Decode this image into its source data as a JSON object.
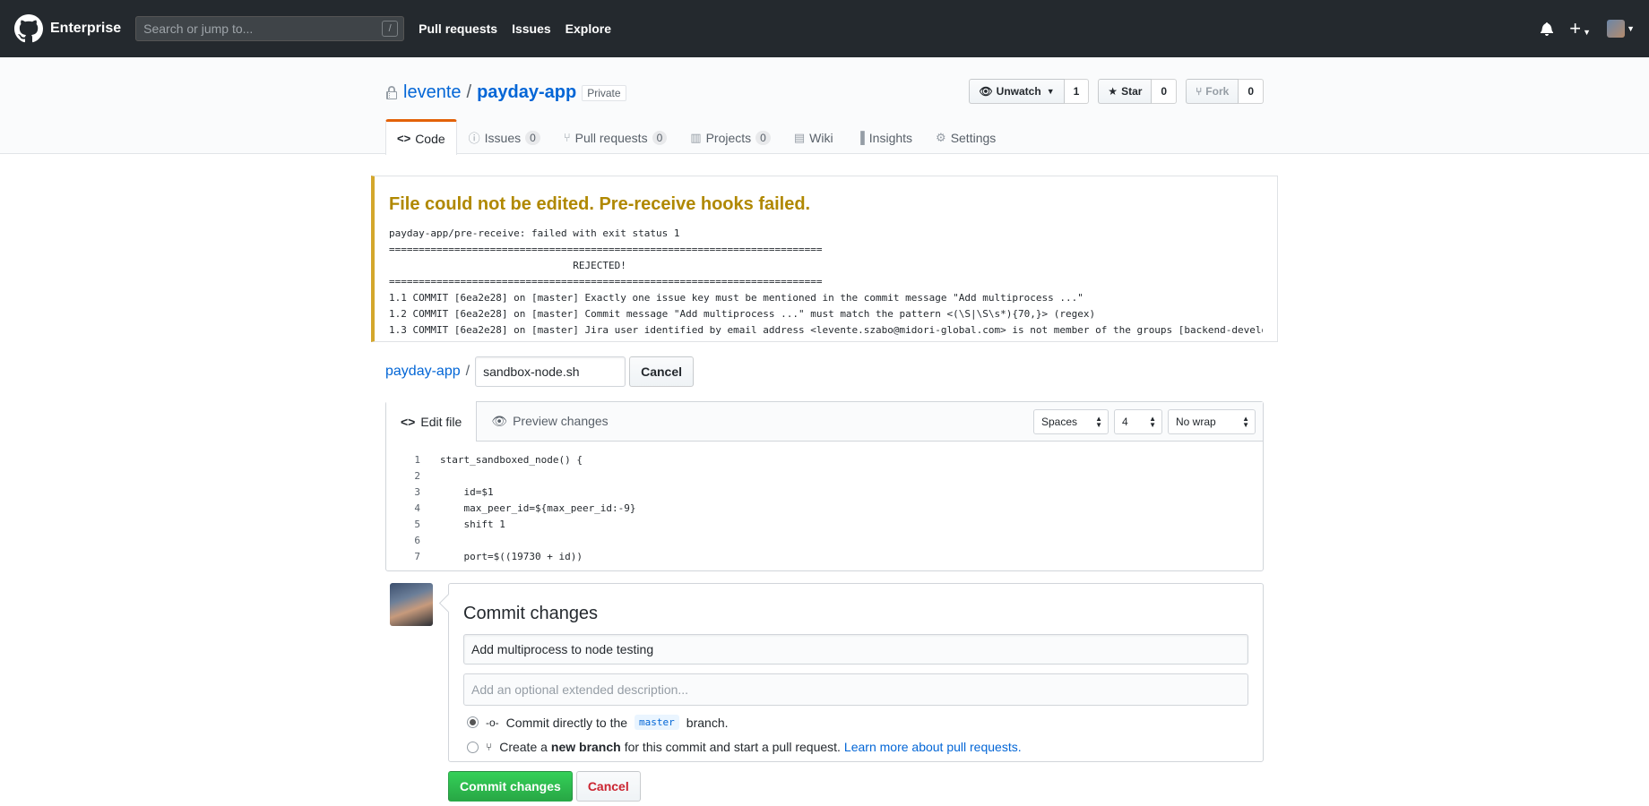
{
  "header": {
    "brand": "Enterprise",
    "search_placeholder": "Search or jump to...",
    "search_shortcut": "/",
    "nav": [
      "Pull requests",
      "Issues",
      "Explore"
    ]
  },
  "repo": {
    "owner": "levente",
    "separator": "/",
    "name": "payday-app",
    "visibility": "Private",
    "actions": {
      "watch_label": "Unwatch",
      "watch_count": "1",
      "star_label": "Star",
      "star_count": "0",
      "fork_label": "Fork",
      "fork_count": "0"
    },
    "tabs": [
      {
        "label": "Code",
        "icon": "code-icon",
        "count": null,
        "selected": true
      },
      {
        "label": "Issues",
        "icon": "issue-icon",
        "count": "0"
      },
      {
        "label": "Pull requests",
        "icon": "pull-request-icon",
        "count": "0"
      },
      {
        "label": "Projects",
        "icon": "project-icon",
        "count": "0"
      },
      {
        "label": "Wiki",
        "icon": "book-icon",
        "count": null
      },
      {
        "label": "Insights",
        "icon": "graph-icon",
        "count": null
      },
      {
        "label": "Settings",
        "icon": "gear-icon",
        "count": null
      }
    ]
  },
  "flash": {
    "title": "File could not be edited. Pre-receive hooks failed.",
    "lines": [
      "payday-app/pre-receive: failed with exit status 1",
      "=========================================================================",
      "                               REJECTED!",
      "=========================================================================",
      "1.1 COMMIT [6ea2e28] on [master] Exactly one issue key must be mentioned in the commit message \"Add multiprocess ...\"",
      "1.2 COMMIT [6ea2e28] on [master] Commit message \"Add multiprocess ...\" must match the pattern <(\\S|\\S\\s*){70,}> (regex)",
      "1.3 COMMIT [6ea2e28] on [master] Jira user identified by email address <levente.szabo@midori-global.com> is not member of the groups [backend-developers]"
    ]
  },
  "editor": {
    "breadcrumb_repo": "payday-app",
    "filename": "sandbox-node.sh",
    "cancel_label": "Cancel",
    "tab_edit": "Edit file",
    "tab_preview": "Preview changes",
    "indent_mode": "Spaces",
    "indent_size": "4",
    "wrap_mode": "No wrap",
    "code": [
      {
        "n": "1",
        "text": "start_sandboxed_node() {"
      },
      {
        "n": "2",
        "text": ""
      },
      {
        "n": "3",
        "text": "    id=$1"
      },
      {
        "n": "4",
        "text": "    max_peer_id=${max_peer_id:-9}"
      },
      {
        "n": "5",
        "text": "    shift 1"
      },
      {
        "n": "6",
        "text": ""
      },
      {
        "n": "7",
        "text": "    port=$((19730 + id))"
      }
    ]
  },
  "commit": {
    "title": "Commit changes",
    "summary_value": "Add multiprocess to node testing",
    "description_placeholder": "Add an optional extended description...",
    "option_direct_prefix": "Commit directly to the",
    "option_direct_branch": "master",
    "option_direct_suffix": "branch.",
    "option_new_prefix": "Create a",
    "option_new_bold": "new branch",
    "option_new_suffix": "for this commit and start a pull request.",
    "option_new_link": "Learn more about pull requests.",
    "submit_label": "Commit changes",
    "cancel_label": "Cancel"
  }
}
